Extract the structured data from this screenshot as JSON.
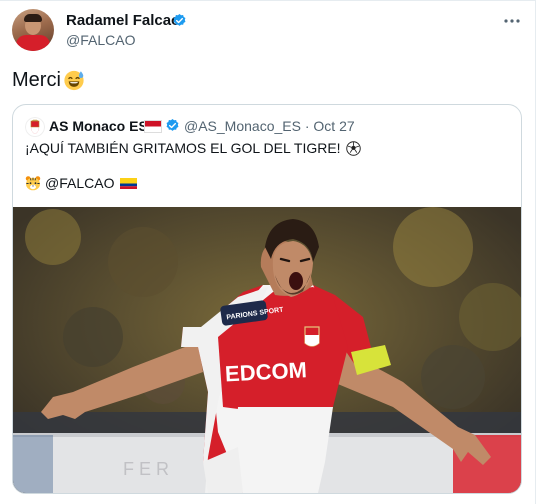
{
  "tweet": {
    "author": {
      "name": "Radamel Falcao",
      "handle": "@FALCAO"
    },
    "text": "Merci",
    "text_emoji": "sweat-smile-emoji"
  },
  "quote": {
    "author": {
      "name": "AS Monaco ES",
      "handle": "@AS_Monaco_ES",
      "date": "Oct 27",
      "separator": "·"
    },
    "line1": "¡AQUÍ TAMBIÉN GRITAMOS EL GOL DEL TIGRE!",
    "line2": "@FALCAO",
    "photo": {
      "sponsor_text": "EDCOM",
      "sleeve_text": "PARIONS SPORT",
      "board_text": "F E R"
    }
  },
  "colors": {
    "verified": "#1d9bf0",
    "monaco_red": "#d51f2a",
    "text_secondary": "#536471",
    "border": "#cfd9de"
  }
}
